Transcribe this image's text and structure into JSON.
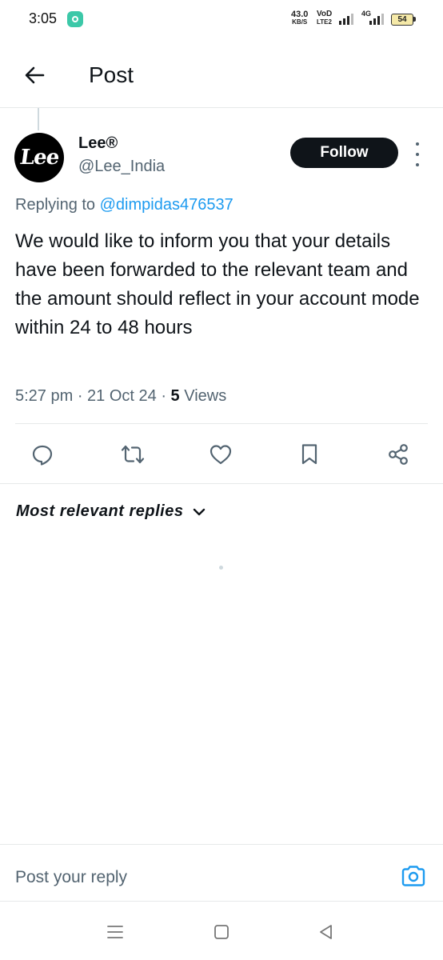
{
  "status_bar": {
    "time": "3:05",
    "speed_value": "43.0",
    "speed_unit": "KB/S",
    "volte_top": "VoD",
    "volte_bottom": "LTE2",
    "network": "4G",
    "battery": "54"
  },
  "header": {
    "title": "Post"
  },
  "post": {
    "author_name": "Lee®",
    "author_handle": "@Lee_India",
    "avatar_text": "Lee",
    "follow_label": "Follow",
    "replying_prefix": "Replying to",
    "replying_to": "@dimpidas476537",
    "text": "We would like to inform you that your details have been forwarded to the relevant team and the amount should reflect in your account mode within 24 to 48 hours",
    "time": "5:27 pm",
    "date": "21 Oct 24",
    "views_count": "5",
    "views_label": "Views"
  },
  "actions": [
    "reply-icon",
    "repost-icon",
    "like-icon",
    "bookmark-icon",
    "share-icon"
  ],
  "replies": {
    "sort_label": "Most relevant replies"
  },
  "composer": {
    "placeholder": "Post your reply"
  },
  "colors": {
    "text": "#0f1419",
    "secondary": "#536471",
    "link": "#1d9bf0",
    "divider": "#e7e9ea"
  }
}
